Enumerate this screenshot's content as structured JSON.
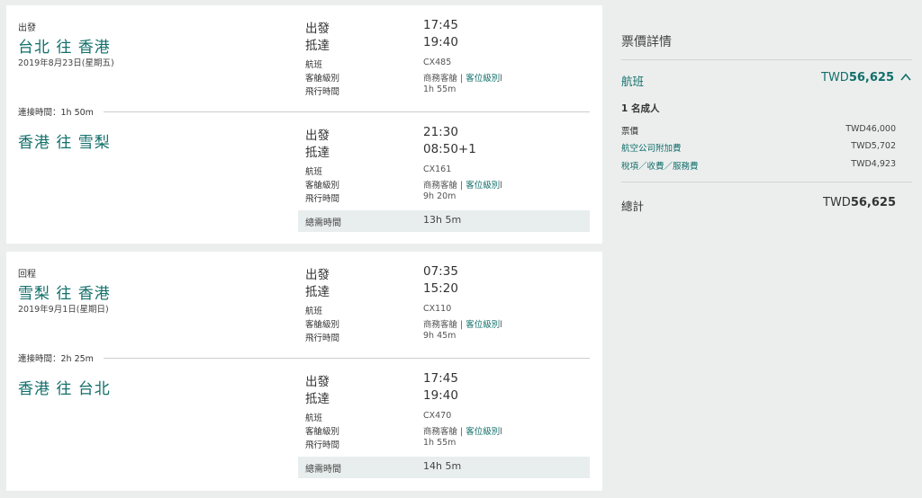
{
  "outbound": {
    "label": "出發",
    "date": "2019年8月23日(星期五)",
    "connection": "連接時間：1h 50m",
    "total_label": "總需時間",
    "total_time": "13h 5m",
    "legs": [
      {
        "route": "台北 往 香港",
        "depart_label": "出發",
        "depart_time": "17:45",
        "arrive_label": "抵達",
        "arrive_time": "19:40",
        "flight_label": "航班",
        "flight_no": "CX485",
        "cabin_label": "客艙級別",
        "cabin": "商務客艙",
        "class_link": "客位級別",
        "duration_label": "飛行時間",
        "duration": "1h 55m"
      },
      {
        "route": "香港 往 雪梨",
        "depart_label": "出發",
        "depart_time": "21:30",
        "arrive_label": "抵達",
        "arrive_time": "08:50+1",
        "flight_label": "航班",
        "flight_no": "CX161",
        "cabin_label": "客艙級別",
        "cabin": "商務客艙",
        "class_link": "客位級別",
        "duration_label": "飛行時間",
        "duration": "9h 20m"
      }
    ]
  },
  "return": {
    "label": "回程",
    "date": "2019年9月1日(星期日)",
    "connection": "連接時間：2h 25m",
    "total_label": "總需時間",
    "total_time": "14h 5m",
    "legs": [
      {
        "route": "雪梨 往 香港",
        "depart_label": "出發",
        "depart_time": "07:35",
        "arrive_label": "抵達",
        "arrive_time": "15:20",
        "flight_label": "航班",
        "flight_no": "CX110",
        "cabin_label": "客艙級別",
        "cabin": "商務客艙",
        "class_link": "客位級別",
        "duration_label": "飛行時間",
        "duration": "9h 45m"
      },
      {
        "route": "香港 往 台北",
        "depart_label": "出發",
        "depart_time": "17:45",
        "arrive_label": "抵達",
        "arrive_time": "19:40",
        "flight_label": "航班",
        "flight_no": "CX470",
        "cabin_label": "客艙級別",
        "cabin": "商務客艙",
        "class_link": "客位級別",
        "duration_label": "飛行時間",
        "duration": "1h 55m"
      }
    ]
  },
  "fare": {
    "title": "票價詳情",
    "flight_label": "航班",
    "flight_currency": "TWD",
    "flight_amount": "56,625",
    "chevron_icon": "chevron-up-icon",
    "passengers": "1 名成人",
    "rows": [
      {
        "label": "票價",
        "value": "TWD46,000",
        "link": false
      },
      {
        "label": "航空公司附加費",
        "value": "TWD5,702",
        "link": true
      },
      {
        "label": "稅項／收費／服務費",
        "value": "TWD4,923",
        "link": true
      }
    ],
    "total_label": "總計",
    "total_currency": "TWD",
    "total_amount": "56,625"
  },
  "colors": {
    "accent": "#116f6a",
    "background": "#eceeee",
    "card": "#ffffff",
    "summary_bar": "#e8eeed"
  }
}
